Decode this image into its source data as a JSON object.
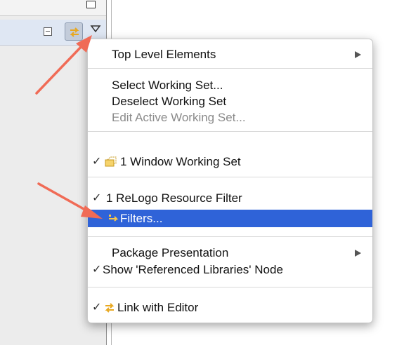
{
  "colors": {
    "selection": "#2f63d8",
    "annotation_arrow": "#f06b56",
    "disabled_text": "#8a8a8a"
  },
  "menu": {
    "top_level_elements": "Top Level Elements",
    "select_working_set": "Select Working Set...",
    "deselect_working_set": "Deselect Working Set",
    "edit_active_working_set": "Edit Active Working Set...",
    "window_working_set": "1 Window Working Set",
    "relogo_resource_filter": "1 ReLogo Resource Filter",
    "filters": "Filters...",
    "package_presentation": "Package Presentation",
    "show_referenced_libraries": "Show 'Referenced Libraries' Node",
    "link_with_editor": "Link with Editor",
    "check_mark": "✓"
  }
}
